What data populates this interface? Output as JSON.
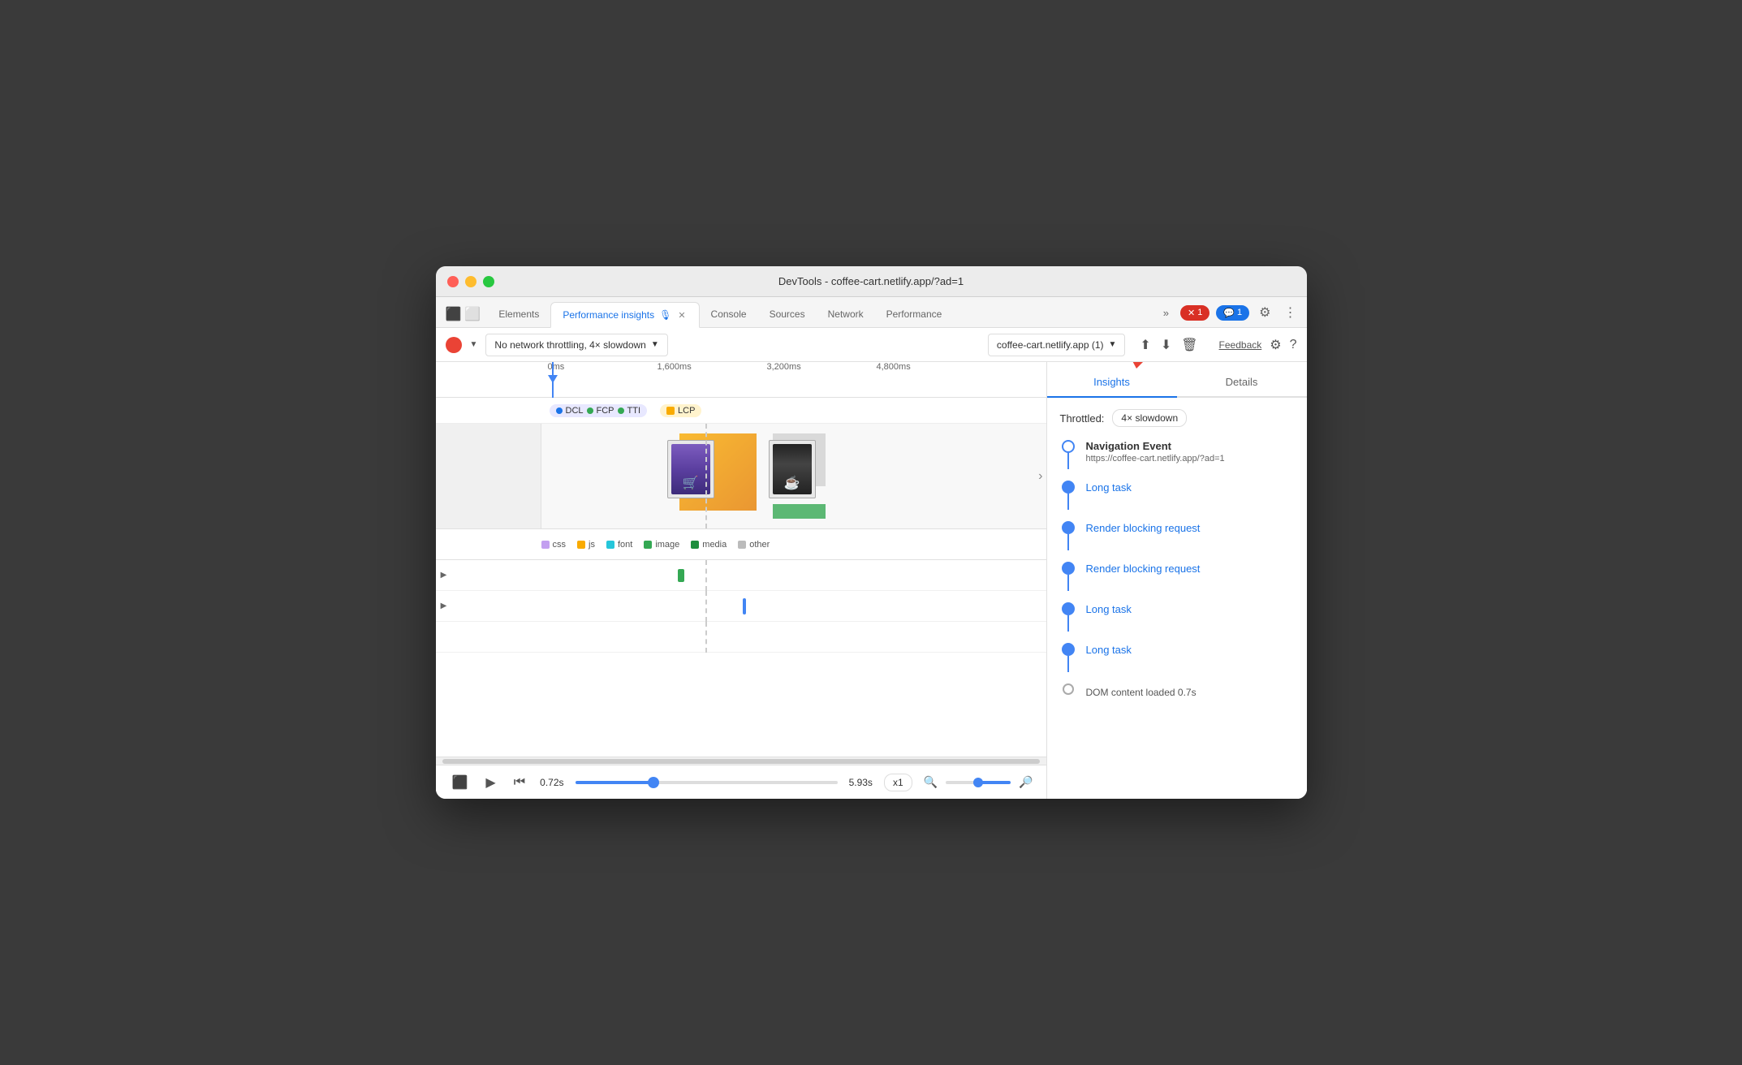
{
  "window": {
    "title": "DevTools - coffee-cart.netlify.app/?ad=1"
  },
  "tabs": {
    "items": [
      {
        "label": "Elements",
        "active": false,
        "closable": false
      },
      {
        "label": "Performance insights",
        "active": true,
        "closable": true
      },
      {
        "label": "Console",
        "active": false,
        "closable": false
      },
      {
        "label": "Sources",
        "active": false,
        "closable": false
      },
      {
        "label": "Network",
        "active": false,
        "closable": false
      },
      {
        "label": "Performance",
        "active": false,
        "closable": false
      }
    ],
    "more_label": "»",
    "error_badge": "1",
    "message_badge": "1"
  },
  "toolbar": {
    "throttle_label": "No network throttling, 4× slowdown",
    "url_label": "coffee-cart.netlify.app (1)",
    "feedback_label": "Feedback"
  },
  "timeline": {
    "markers": [
      "0ms",
      "1,600ms",
      "3,200ms",
      "4,800ms"
    ],
    "milestones": [
      "DCL",
      "FCP",
      "TTI",
      "LCP"
    ],
    "time_start": "0.72s",
    "time_end": "5.93s",
    "speed": "x1"
  },
  "legend": {
    "items": [
      {
        "label": "css",
        "color": "css"
      },
      {
        "label": "js",
        "color": "js"
      },
      {
        "label": "font",
        "color": "font"
      },
      {
        "label": "image",
        "color": "image"
      },
      {
        "label": "media",
        "color": "media"
      },
      {
        "label": "other",
        "color": "other"
      }
    ]
  },
  "insights": {
    "tab_insights": "Insights",
    "tab_details": "Details",
    "throttled_label": "Throttled:",
    "throttle_value": "4× slowdown",
    "nav_event_title": "Navigation Event",
    "nav_event_url": "https://coffee-cart.netlify.app/?ad=1",
    "items": [
      {
        "label": "Long task",
        "type": "link"
      },
      {
        "label": "Render blocking request",
        "type": "link"
      },
      {
        "label": "Render blocking request",
        "type": "link"
      },
      {
        "label": "Long task",
        "type": "link"
      },
      {
        "label": "Long task",
        "type": "link"
      },
      {
        "label": "DOM content loaded 0.7s",
        "type": "dom"
      }
    ]
  }
}
